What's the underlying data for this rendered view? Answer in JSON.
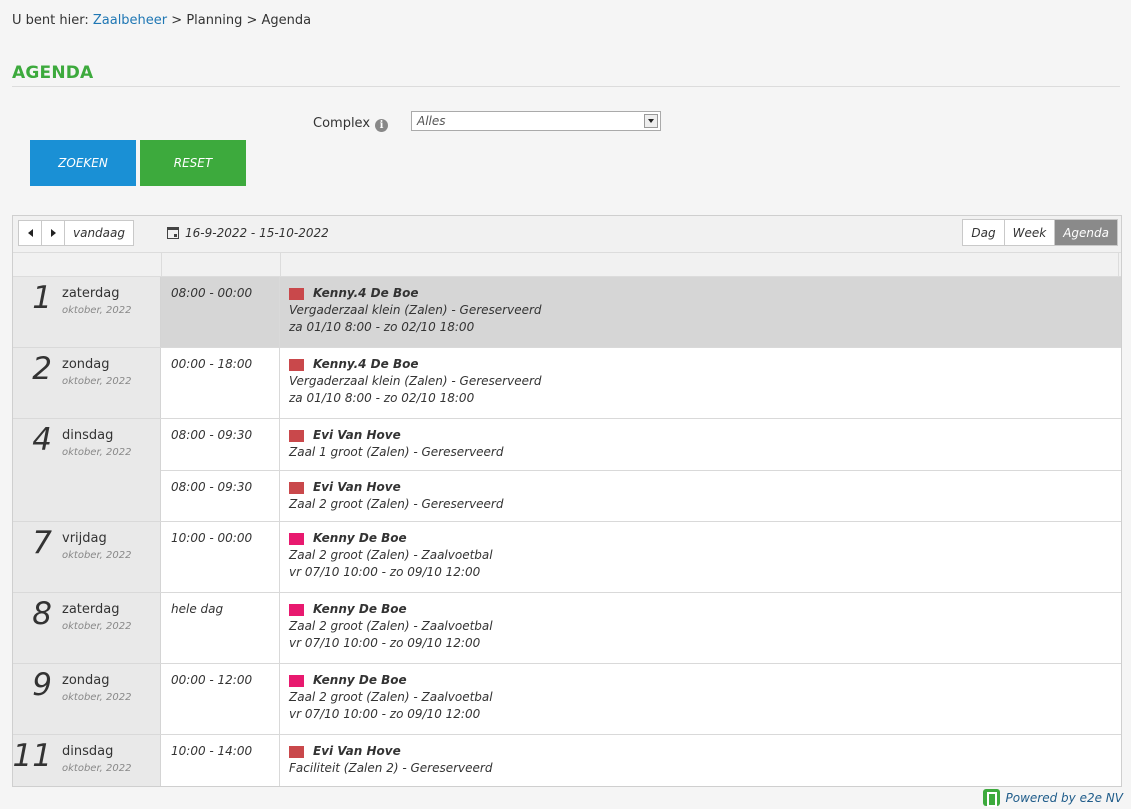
{
  "breadcrumb": {
    "prefix": "U bent hier:",
    "items": [
      "Zaalbeheer",
      "Planning",
      "Agenda"
    ],
    "separator": ">"
  },
  "page": {
    "title": "AGENDA"
  },
  "filter": {
    "complex_label": "Complex",
    "complex_value": "Alles"
  },
  "buttons": {
    "search": "ZOEKEN",
    "reset": "RESET"
  },
  "calendar": {
    "today_label": "vandaag",
    "date_range": "16-9-2022 - 15-10-2022",
    "views": [
      "Dag",
      "Week",
      "Agenda"
    ],
    "active_view": "Agenda",
    "days": [
      {
        "num": "1",
        "weekday": "zaterdag",
        "month": "oktober, 2022",
        "events": [
          {
            "time": "08:00 - 00:00",
            "color": "#c9484b",
            "title": "Kenny.4 De Boe",
            "desc": "Vergaderzaal klein (Zalen) - Gereserveerd",
            "range": "za 01/10 8:00 - zo 02/10 18:00",
            "selected": true
          }
        ]
      },
      {
        "num": "2",
        "weekday": "zondag",
        "month": "oktober, 2022",
        "events": [
          {
            "time": "00:00 - 18:00",
            "color": "#c9484b",
            "title": "Kenny.4 De Boe",
            "desc": "Vergaderzaal klein (Zalen) - Gereserveerd",
            "range": "za 01/10 8:00 - zo 02/10 18:00"
          }
        ]
      },
      {
        "num": "4",
        "weekday": "dinsdag",
        "month": "oktober, 2022",
        "events": [
          {
            "time": "08:00 - 09:30",
            "color": "#c9484b",
            "title": "Evi Van Hove",
            "desc": "Zaal 1 groot (Zalen) - Gereserveerd"
          },
          {
            "time": "08:00 - 09:30",
            "color": "#c9484b",
            "title": "Evi Van Hove",
            "desc": "Zaal 2 groot (Zalen) - Gereserveerd"
          }
        ]
      },
      {
        "num": "7",
        "weekday": "vrijdag",
        "month": "oktober, 2022",
        "events": [
          {
            "time": "10:00 - 00:00",
            "color": "#e8196f",
            "title": "Kenny De Boe",
            "desc": "Zaal 2 groot (Zalen) - Zaalvoetbal",
            "range": "vr 07/10 10:00 - zo 09/10 12:00"
          }
        ]
      },
      {
        "num": "8",
        "weekday": "zaterdag",
        "month": "oktober, 2022",
        "events": [
          {
            "time": "hele dag",
            "color": "#e8196f",
            "title": "Kenny De Boe",
            "desc": "Zaal 2 groot (Zalen) - Zaalvoetbal",
            "range": "vr 07/10 10:00 - zo 09/10 12:00"
          }
        ]
      },
      {
        "num": "9",
        "weekday": "zondag",
        "month": "oktober, 2022",
        "events": [
          {
            "time": "00:00 - 12:00",
            "color": "#e8196f",
            "title": "Kenny De Boe",
            "desc": "Zaal 2 groot (Zalen) - Zaalvoetbal",
            "range": "vr 07/10 10:00 - zo 09/10 12:00"
          }
        ]
      },
      {
        "num": "11",
        "weekday": "dinsdag",
        "month": "oktober, 2022",
        "events": [
          {
            "time": "10:00 - 14:00",
            "color": "#c9484b",
            "title": "Evi Van Hove",
            "desc": "Faciliteit (Zalen 2) - Gereserveerd"
          }
        ]
      }
    ]
  },
  "footer": {
    "powered": "Powered by e2e NV"
  }
}
